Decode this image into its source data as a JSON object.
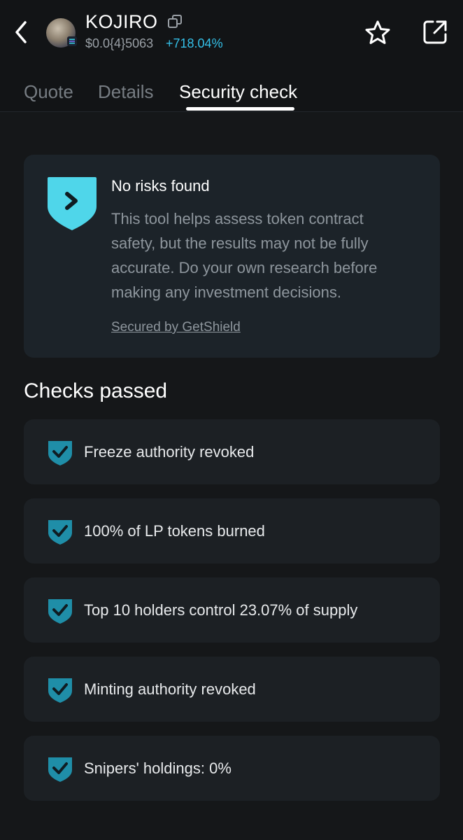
{
  "header": {
    "token_name": "KOJIRO",
    "price": "$0.0{4}5063",
    "change": "+718.04%",
    "icons": {
      "back": "chevron-left-icon",
      "copy": "copy-icon",
      "star": "star-icon",
      "share": "share-icon"
    }
  },
  "tabs": [
    {
      "label": "Quote",
      "active": false
    },
    {
      "label": "Details",
      "active": false
    },
    {
      "label": "Security check",
      "active": true
    }
  ],
  "risk_card": {
    "title": "No risks found",
    "description": "This tool helps assess token contract safety, but the results may not be fully accurate. Do your own research before making any investment decisions.",
    "secured_by": "Secured by GetShield"
  },
  "checks": {
    "title": "Checks passed",
    "items": [
      {
        "label": "Freeze authority revoked"
      },
      {
        "label": "100% of LP tokens burned"
      },
      {
        "label": "Top 10 holders control 23.07% of supply"
      },
      {
        "label": "Minting authority revoked"
      },
      {
        "label": "Snipers' holdings: 0%"
      }
    ]
  },
  "colors": {
    "accent": "#34c0e8",
    "shield": "#4fd6ea",
    "check_shield": "#1f8ea8",
    "background": "#151719",
    "card": "#1c2329"
  }
}
